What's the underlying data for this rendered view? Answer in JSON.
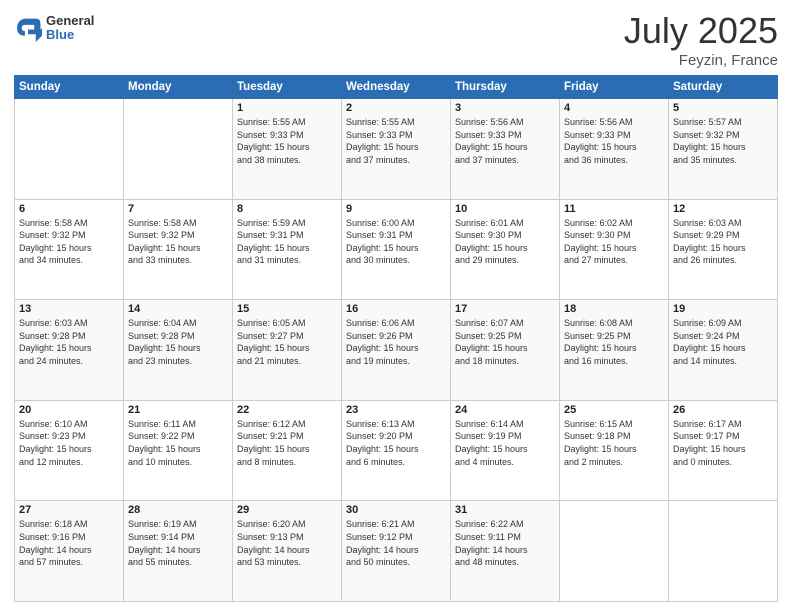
{
  "header": {
    "logo_general": "General",
    "logo_blue": "Blue",
    "title": "July 2025",
    "location": "Feyzin, France"
  },
  "weekdays": [
    "Sunday",
    "Monday",
    "Tuesday",
    "Wednesday",
    "Thursday",
    "Friday",
    "Saturday"
  ],
  "weeks": [
    [
      {
        "day": "",
        "info": ""
      },
      {
        "day": "",
        "info": ""
      },
      {
        "day": "1",
        "info": "Sunrise: 5:55 AM\nSunset: 9:33 PM\nDaylight: 15 hours\nand 38 minutes."
      },
      {
        "day": "2",
        "info": "Sunrise: 5:55 AM\nSunset: 9:33 PM\nDaylight: 15 hours\nand 37 minutes."
      },
      {
        "day": "3",
        "info": "Sunrise: 5:56 AM\nSunset: 9:33 PM\nDaylight: 15 hours\nand 37 minutes."
      },
      {
        "day": "4",
        "info": "Sunrise: 5:56 AM\nSunset: 9:33 PM\nDaylight: 15 hours\nand 36 minutes."
      },
      {
        "day": "5",
        "info": "Sunrise: 5:57 AM\nSunset: 9:32 PM\nDaylight: 15 hours\nand 35 minutes."
      }
    ],
    [
      {
        "day": "6",
        "info": "Sunrise: 5:58 AM\nSunset: 9:32 PM\nDaylight: 15 hours\nand 34 minutes."
      },
      {
        "day": "7",
        "info": "Sunrise: 5:58 AM\nSunset: 9:32 PM\nDaylight: 15 hours\nand 33 minutes."
      },
      {
        "day": "8",
        "info": "Sunrise: 5:59 AM\nSunset: 9:31 PM\nDaylight: 15 hours\nand 31 minutes."
      },
      {
        "day": "9",
        "info": "Sunrise: 6:00 AM\nSunset: 9:31 PM\nDaylight: 15 hours\nand 30 minutes."
      },
      {
        "day": "10",
        "info": "Sunrise: 6:01 AM\nSunset: 9:30 PM\nDaylight: 15 hours\nand 29 minutes."
      },
      {
        "day": "11",
        "info": "Sunrise: 6:02 AM\nSunset: 9:30 PM\nDaylight: 15 hours\nand 27 minutes."
      },
      {
        "day": "12",
        "info": "Sunrise: 6:03 AM\nSunset: 9:29 PM\nDaylight: 15 hours\nand 26 minutes."
      }
    ],
    [
      {
        "day": "13",
        "info": "Sunrise: 6:03 AM\nSunset: 9:28 PM\nDaylight: 15 hours\nand 24 minutes."
      },
      {
        "day": "14",
        "info": "Sunrise: 6:04 AM\nSunset: 9:28 PM\nDaylight: 15 hours\nand 23 minutes."
      },
      {
        "day": "15",
        "info": "Sunrise: 6:05 AM\nSunset: 9:27 PM\nDaylight: 15 hours\nand 21 minutes."
      },
      {
        "day": "16",
        "info": "Sunrise: 6:06 AM\nSunset: 9:26 PM\nDaylight: 15 hours\nand 19 minutes."
      },
      {
        "day": "17",
        "info": "Sunrise: 6:07 AM\nSunset: 9:25 PM\nDaylight: 15 hours\nand 18 minutes."
      },
      {
        "day": "18",
        "info": "Sunrise: 6:08 AM\nSunset: 9:25 PM\nDaylight: 15 hours\nand 16 minutes."
      },
      {
        "day": "19",
        "info": "Sunrise: 6:09 AM\nSunset: 9:24 PM\nDaylight: 15 hours\nand 14 minutes."
      }
    ],
    [
      {
        "day": "20",
        "info": "Sunrise: 6:10 AM\nSunset: 9:23 PM\nDaylight: 15 hours\nand 12 minutes."
      },
      {
        "day": "21",
        "info": "Sunrise: 6:11 AM\nSunset: 9:22 PM\nDaylight: 15 hours\nand 10 minutes."
      },
      {
        "day": "22",
        "info": "Sunrise: 6:12 AM\nSunset: 9:21 PM\nDaylight: 15 hours\nand 8 minutes."
      },
      {
        "day": "23",
        "info": "Sunrise: 6:13 AM\nSunset: 9:20 PM\nDaylight: 15 hours\nand 6 minutes."
      },
      {
        "day": "24",
        "info": "Sunrise: 6:14 AM\nSunset: 9:19 PM\nDaylight: 15 hours\nand 4 minutes."
      },
      {
        "day": "25",
        "info": "Sunrise: 6:15 AM\nSunset: 9:18 PM\nDaylight: 15 hours\nand 2 minutes."
      },
      {
        "day": "26",
        "info": "Sunrise: 6:17 AM\nSunset: 9:17 PM\nDaylight: 15 hours\nand 0 minutes."
      }
    ],
    [
      {
        "day": "27",
        "info": "Sunrise: 6:18 AM\nSunset: 9:16 PM\nDaylight: 14 hours\nand 57 minutes."
      },
      {
        "day": "28",
        "info": "Sunrise: 6:19 AM\nSunset: 9:14 PM\nDaylight: 14 hours\nand 55 minutes."
      },
      {
        "day": "29",
        "info": "Sunrise: 6:20 AM\nSunset: 9:13 PM\nDaylight: 14 hours\nand 53 minutes."
      },
      {
        "day": "30",
        "info": "Sunrise: 6:21 AM\nSunset: 9:12 PM\nDaylight: 14 hours\nand 50 minutes."
      },
      {
        "day": "31",
        "info": "Sunrise: 6:22 AM\nSunset: 9:11 PM\nDaylight: 14 hours\nand 48 minutes."
      },
      {
        "day": "",
        "info": ""
      },
      {
        "day": "",
        "info": ""
      }
    ]
  ]
}
